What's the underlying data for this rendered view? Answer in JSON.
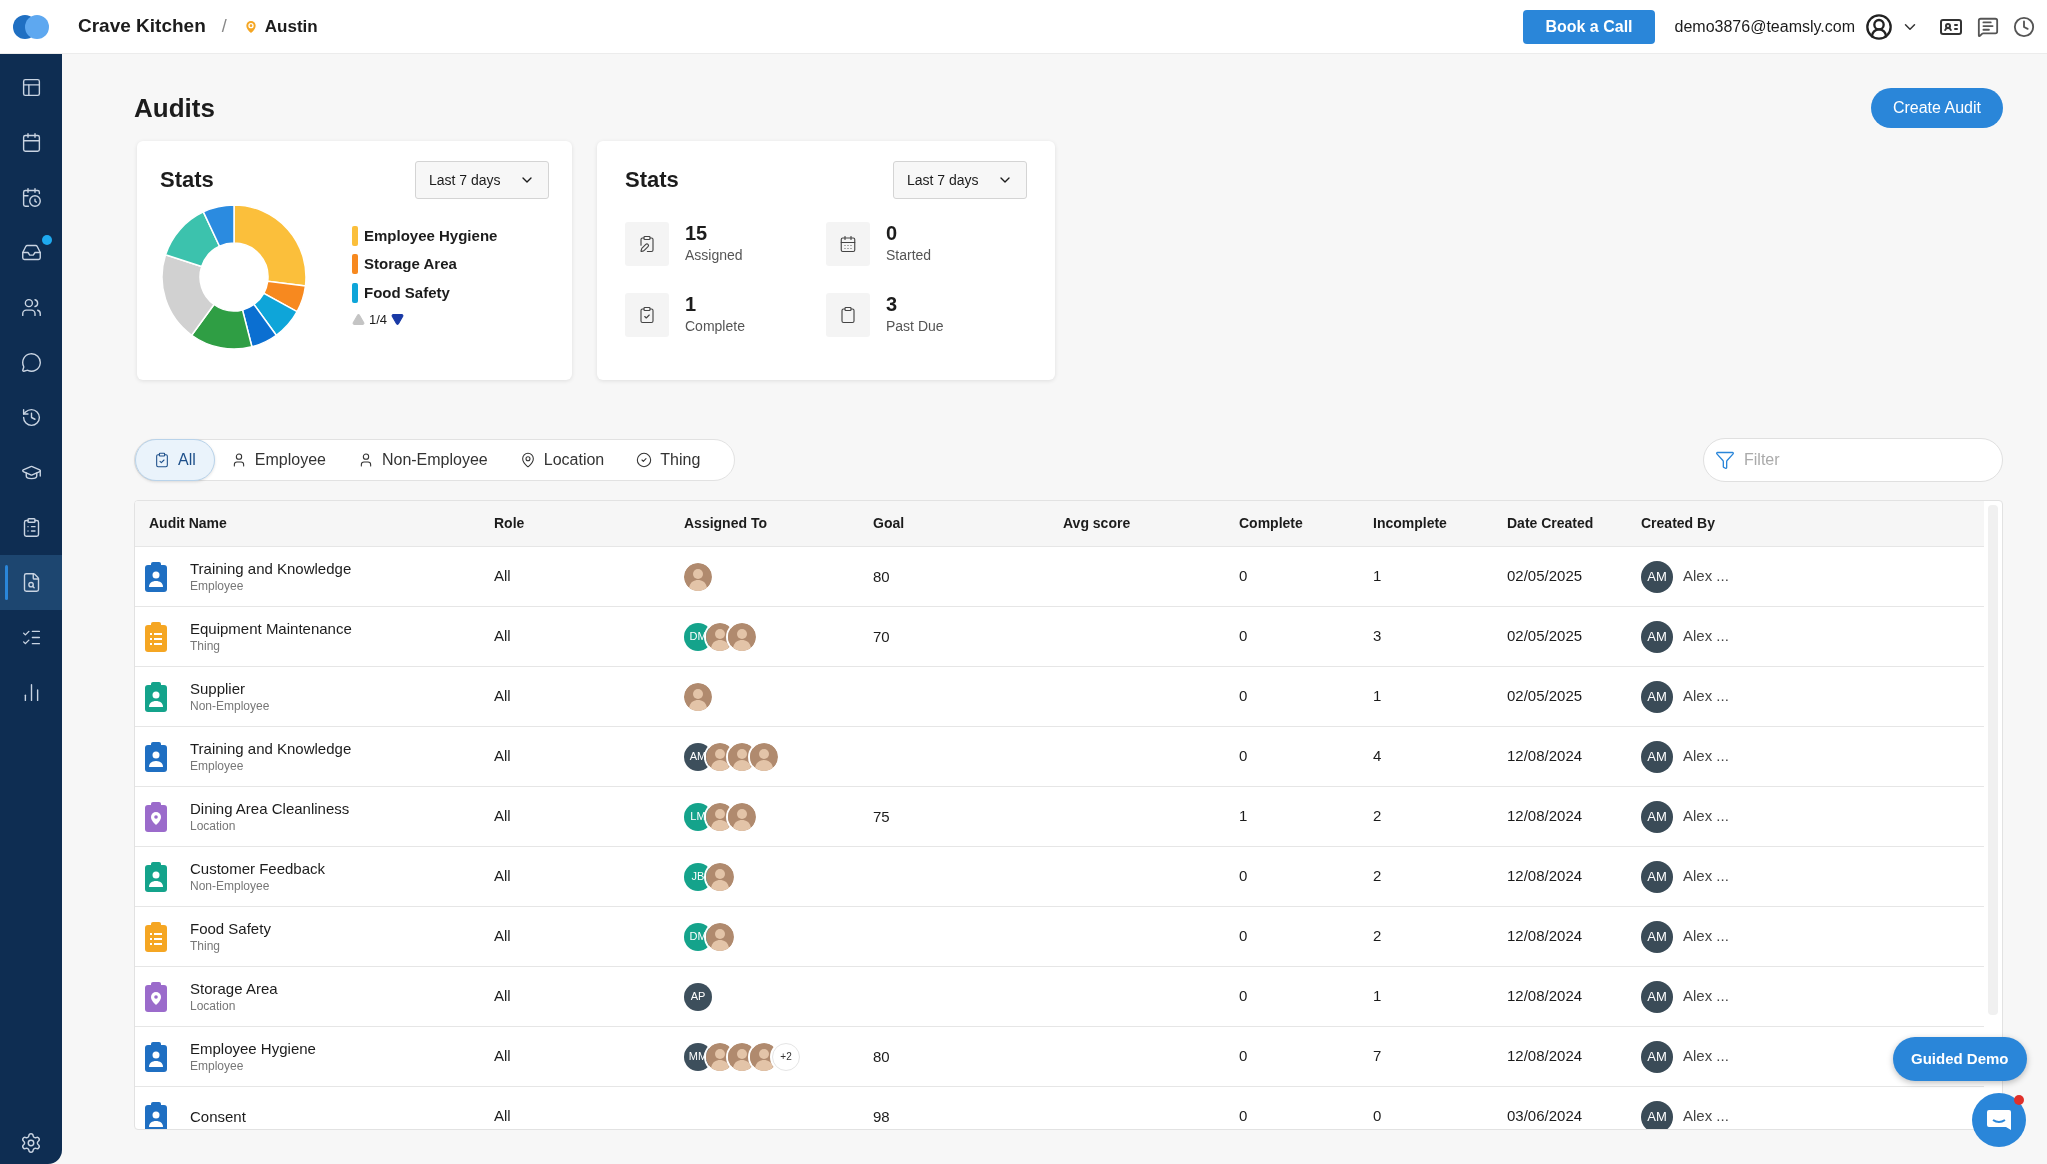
{
  "topbar": {
    "org": "Crave Kitchen",
    "separator": "/",
    "location": "Austin",
    "book_button": "Book a Call",
    "email": "demo3876@teamsly.com"
  },
  "sidebar": {
    "items": [
      {
        "selected": false,
        "dot": false
      },
      {
        "selected": false,
        "dot": false
      },
      {
        "selected": false,
        "dot": false
      },
      {
        "selected": false,
        "dot": true
      },
      {
        "selected": false,
        "dot": false
      },
      {
        "selected": false,
        "dot": false
      },
      {
        "selected": false,
        "dot": false
      },
      {
        "selected": false,
        "dot": false
      },
      {
        "selected": false,
        "dot": false
      },
      {
        "selected": true,
        "dot": false
      },
      {
        "selected": false,
        "dot": false
      },
      {
        "selected": false,
        "dot": false
      }
    ]
  },
  "page": {
    "title": "Audits",
    "create_button": "Create Audit"
  },
  "stats_chart_card": {
    "title": "Stats",
    "period": "Last 7 days",
    "legend": [
      {
        "label": "Employee Hygiene",
        "color": "#fbbf3b"
      },
      {
        "label": "Storage Area",
        "color": "#f7891f"
      },
      {
        "label": "Food Safety",
        "color": "#0ea5d9"
      }
    ],
    "pager": "1/4",
    "pager_prev_disabled": true
  },
  "stats_card": {
    "title": "Stats",
    "period": "Last 7 days",
    "items": [
      {
        "value": "15",
        "label": "Assigned"
      },
      {
        "value": "0",
        "label": "Started"
      },
      {
        "value": "1",
        "label": "Complete"
      },
      {
        "value": "3",
        "label": "Past Due"
      }
    ]
  },
  "filter_tabs": [
    {
      "label": "All",
      "selected": true
    },
    {
      "label": "Employee",
      "selected": false
    },
    {
      "label": "Non-Employee",
      "selected": false
    },
    {
      "label": "Location",
      "selected": false
    },
    {
      "label": "Thing",
      "selected": false
    }
  ],
  "filter": {
    "placeholder": "Filter"
  },
  "table": {
    "columns": [
      "Audit Name",
      "Role",
      "Assigned To",
      "Goal",
      "Avg score",
      "Complete",
      "Incomplete",
      "Date Created",
      "Created By"
    ],
    "rows": [
      {
        "kind": "employee",
        "name": "Training and Knowledge",
        "type": "Employee",
        "role": "All",
        "assignees": [
          {
            "kind": "photo"
          }
        ],
        "goal": "80",
        "complete": "0",
        "incomplete": "1",
        "date": "02/05/2025",
        "creator_initials": "AM",
        "creator": "Alex ..."
      },
      {
        "kind": "thing",
        "name": "Equipment Maintenance",
        "type": "Thing",
        "role": "All",
        "assignees": [
          {
            "kind": "initials",
            "text": "DM",
            "color": "#14a38b"
          },
          {
            "kind": "photo"
          },
          {
            "kind": "photo"
          }
        ],
        "goal": "70",
        "complete": "0",
        "incomplete": "3",
        "date": "02/05/2025",
        "creator_initials": "AM",
        "creator": "Alex ..."
      },
      {
        "kind": "non-employee",
        "name": "Supplier",
        "type": "Non-Employee",
        "role": "All",
        "assignees": [
          {
            "kind": "photo"
          }
        ],
        "complete": "0",
        "incomplete": "1",
        "date": "02/05/2025",
        "creator_initials": "AM",
        "creator": "Alex ..."
      },
      {
        "kind": "employee",
        "name": "Training and Knowledge",
        "type": "Employee",
        "role": "All",
        "assignees": [
          {
            "kind": "initials",
            "text": "AM",
            "color": "#3d4f5c"
          },
          {
            "kind": "photo"
          },
          {
            "kind": "photo"
          },
          {
            "kind": "photo"
          }
        ],
        "complete": "0",
        "incomplete": "4",
        "date": "12/08/2024",
        "creator_initials": "AM",
        "creator": "Alex ..."
      },
      {
        "kind": "location",
        "name": "Dining Area Cleanliness",
        "type": "Location",
        "role": "All",
        "assignees": [
          {
            "kind": "initials",
            "text": "LM",
            "color": "#14a38b"
          },
          {
            "kind": "photo"
          },
          {
            "kind": "photo"
          }
        ],
        "goal": "75",
        "complete": "1",
        "incomplete": "2",
        "date": "12/08/2024",
        "creator_initials": "AM",
        "creator": "Alex ..."
      },
      {
        "kind": "non-employee",
        "name": "Customer Feedback",
        "type": "Non-Employee",
        "role": "All",
        "assignees": [
          {
            "kind": "initials",
            "text": "JB",
            "color": "#14a38b"
          },
          {
            "kind": "photo"
          }
        ],
        "complete": "0",
        "incomplete": "2",
        "date": "12/08/2024",
        "creator_initials": "AM",
        "creator": "Alex ..."
      },
      {
        "kind": "thing",
        "name": "Food Safety",
        "type": "Thing",
        "role": "All",
        "assignees": [
          {
            "kind": "initials",
            "text": "DM",
            "color": "#14a38b"
          },
          {
            "kind": "photo"
          }
        ],
        "complete": "0",
        "incomplete": "2",
        "date": "12/08/2024",
        "creator_initials": "AM",
        "creator": "Alex ..."
      },
      {
        "kind": "location",
        "name": "Storage Area",
        "type": "Location",
        "role": "All",
        "assignees": [
          {
            "kind": "initials",
            "text": "AP",
            "color": "#3d4f5c"
          }
        ],
        "complete": "0",
        "incomplete": "1",
        "date": "12/08/2024",
        "creator_initials": "AM",
        "creator": "Alex ..."
      },
      {
        "kind": "employee",
        "name": "Employee Hygiene",
        "type": "Employee",
        "role": "All",
        "assignees": [
          {
            "kind": "initials",
            "text": "MM",
            "color": "#3d4f5c"
          },
          {
            "kind": "photo"
          },
          {
            "kind": "photo"
          },
          {
            "kind": "photo"
          },
          {
            "kind": "more",
            "text": "+2"
          }
        ],
        "goal": "80",
        "complete": "0",
        "incomplete": "7",
        "date": "12/08/2024",
        "creator_initials": "AM",
        "creator": "Alex ..."
      },
      {
        "kind": "employee",
        "name": "Consent",
        "role": "All",
        "assignees": [],
        "goal": "98",
        "complete": "0",
        "incomplete": "0",
        "date": "03/06/2024",
        "creator_initials": "AM",
        "creator": "Alex ..."
      }
    ]
  },
  "guided_demo_button": "Guided Demo",
  "chat_launcher": {
    "unread": true
  }
}
